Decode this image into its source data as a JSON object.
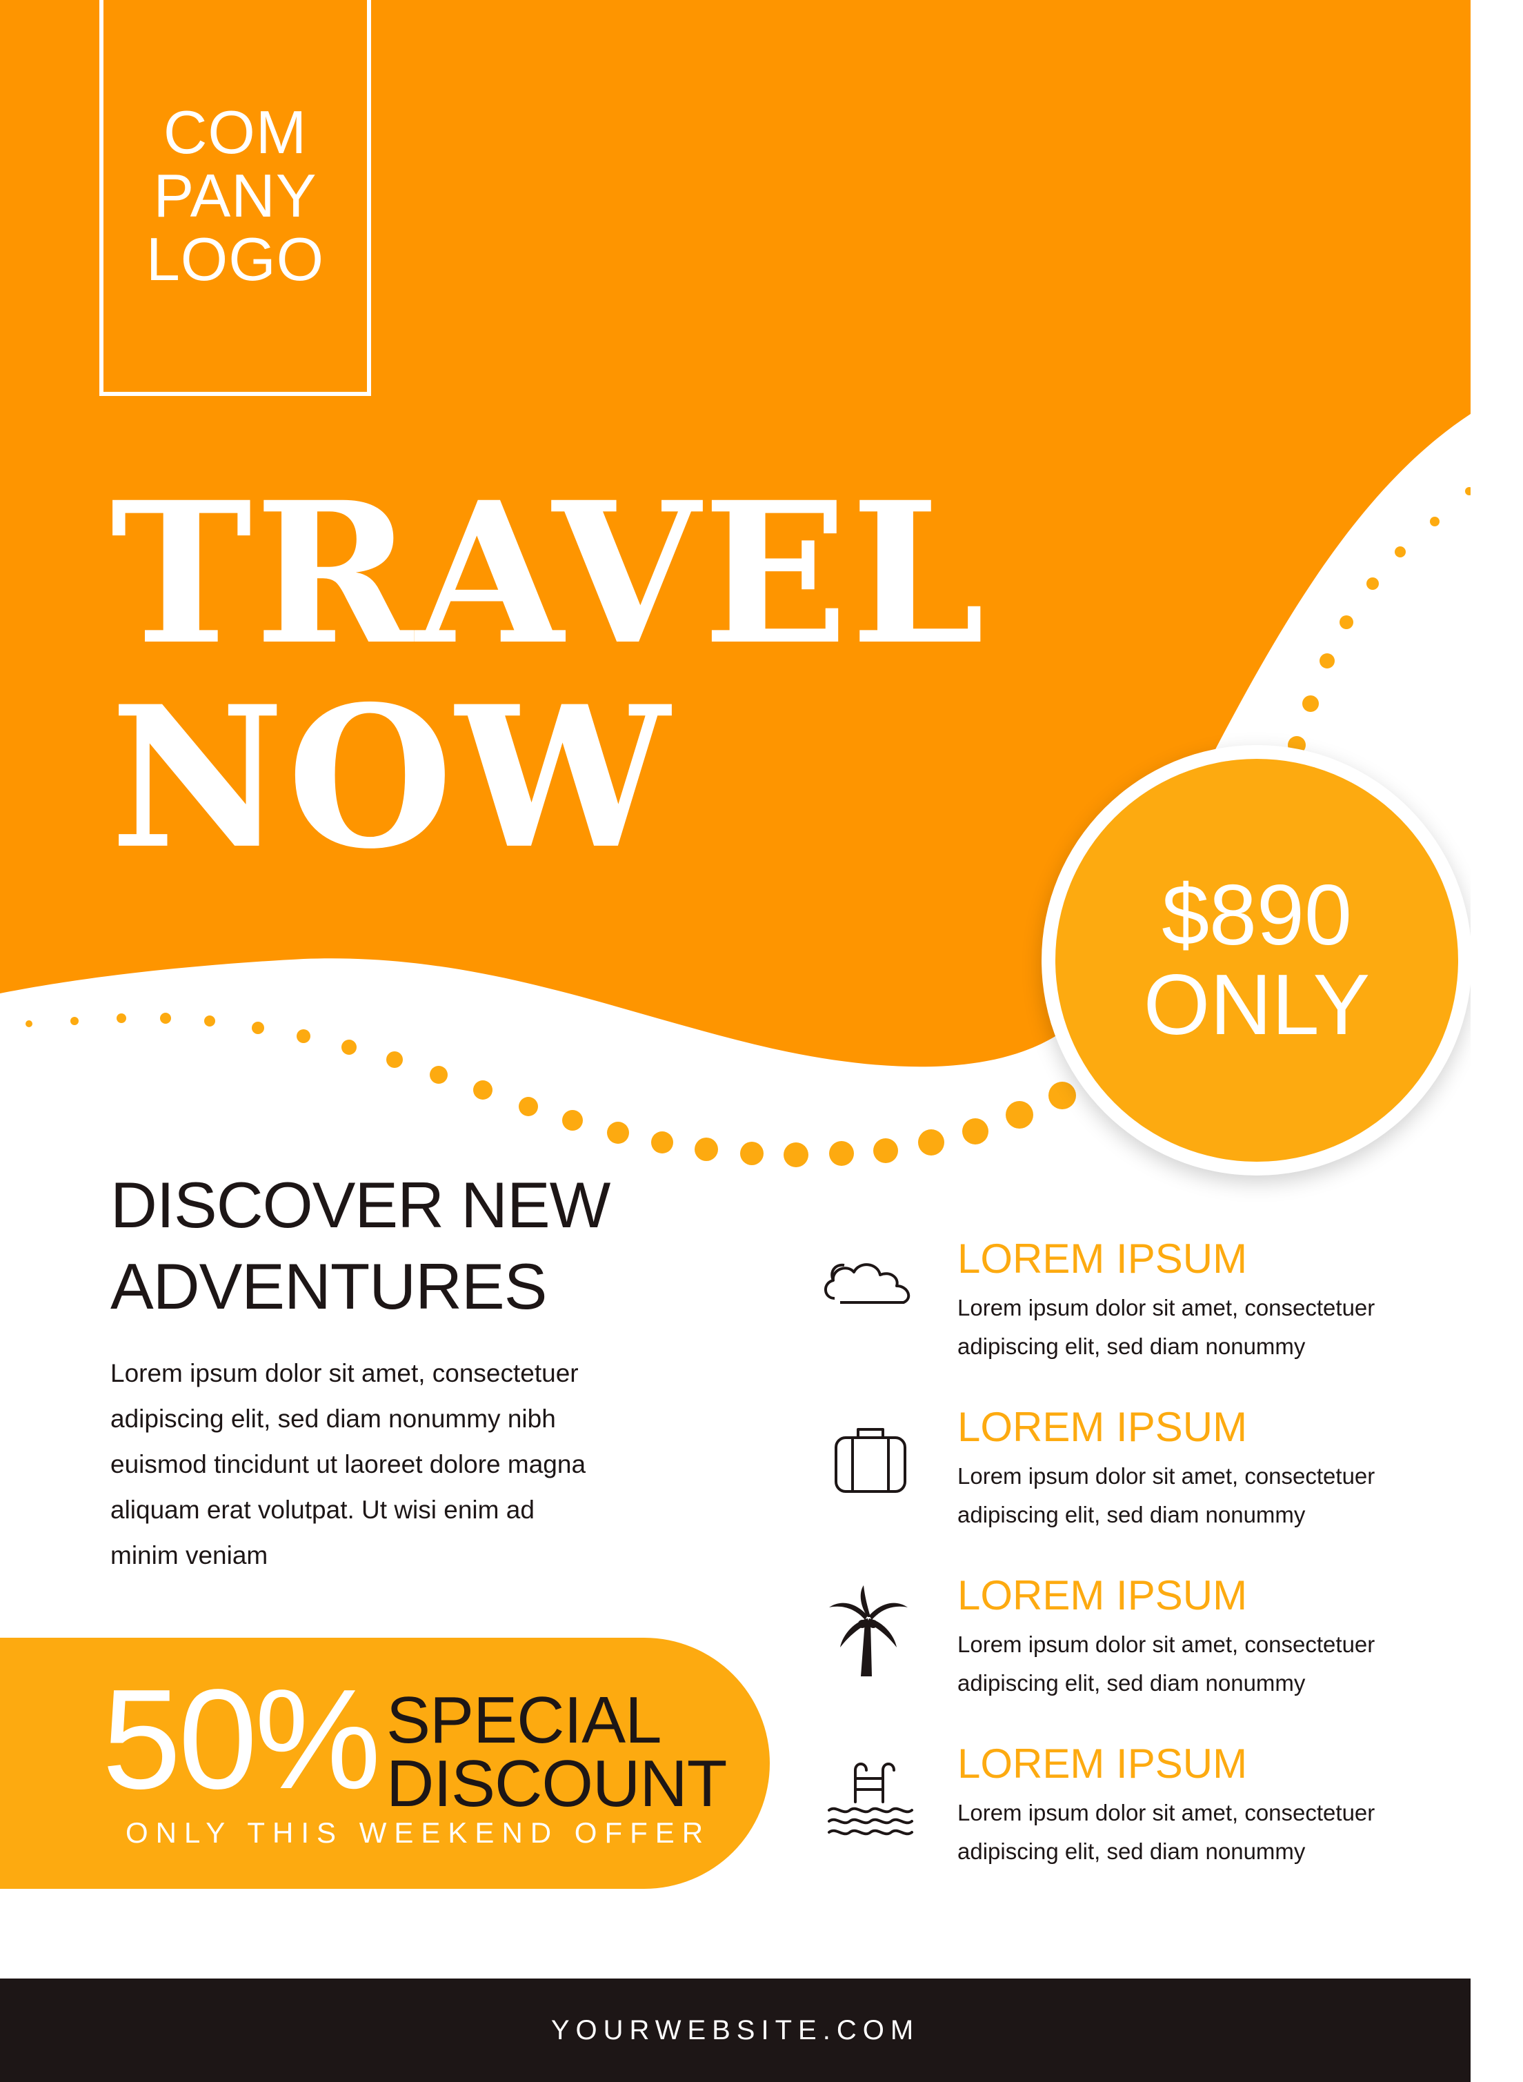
{
  "colors": {
    "orange": "#fe9500",
    "amber": "#fdaa10",
    "dark": "#1d1616",
    "white": "#ffffff"
  },
  "logo": {
    "line1": "COM",
    "line2": "PANY",
    "line3": "LOGO"
  },
  "headline": {
    "line1": "TRAVEL",
    "line2": "NOW"
  },
  "price": {
    "amount": "$890",
    "label": "ONLY"
  },
  "intro": {
    "title_line1": "DISCOVER NEW",
    "title_line2": "ADVENTURES",
    "body": "Lorem ipsum dolor sit amet, consectetuer adipiscing elit, sed diam nonummy nibh euismod tincidunt ut laoreet dolore magna aliquam erat volutpat. Ut wisi enim ad minim veniam"
  },
  "offer": {
    "percent": "50%",
    "special": "SPECIAL",
    "discount": "DISCOUNT",
    "subline": "ONLY THIS WEEKEND OFFER"
  },
  "features": [
    {
      "icon": "cloud-icon",
      "title": "LOREM IPSUM",
      "desc": "Lorem ipsum dolor sit amet, consectetuer adipiscing elit, sed diam nonummy"
    },
    {
      "icon": "suitcase-icon",
      "title": "LOREM IPSUM",
      "desc": "Lorem ipsum dolor sit amet, consectetuer adipiscing elit, sed diam nonummy"
    },
    {
      "icon": "palm-tree-icon",
      "title": "LOREM IPSUM",
      "desc": "Lorem ipsum dolor sit amet, consectetuer adipiscing elit, sed diam nonummy"
    },
    {
      "icon": "pool-ladder-icon",
      "title": "LOREM IPSUM",
      "desc": "Lorem ipsum dolor sit amet, consectetuer adipiscing elit, sed diam nonummy"
    }
  ],
  "footer": {
    "website": "YOURWEBSITE.COM"
  }
}
